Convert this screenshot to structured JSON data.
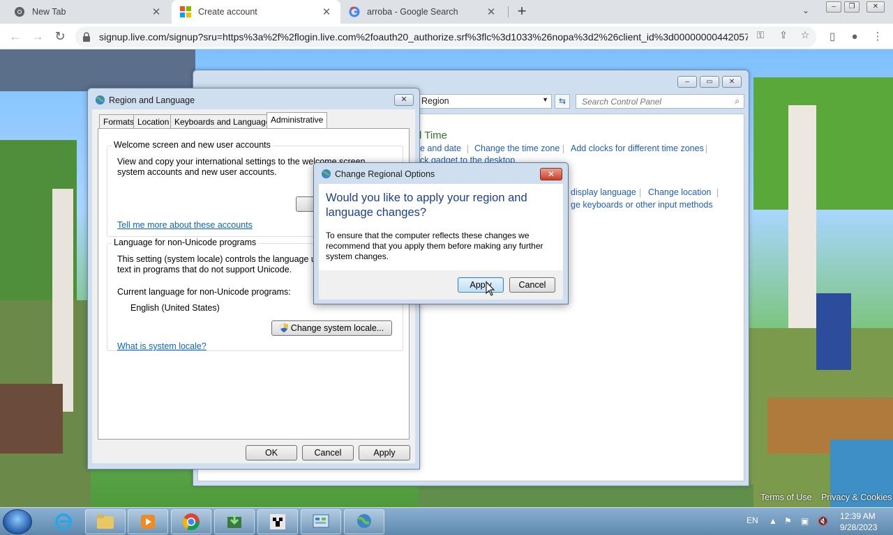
{
  "browser": {
    "tabs": [
      {
        "title": "New Tab",
        "icon": "chrome-icon"
      },
      {
        "title": "Create account",
        "icon": "microsoft-logo-icon"
      },
      {
        "title": "arroba - Google Search",
        "icon": "google-icon"
      }
    ],
    "new_tab_label": "+",
    "url": "signup.live.com/signup?sru=https%3a%2f%2flogin.live.com%2foauth20_authorize.srf%3flc%3d1033%26nopa%3d2%26client_id%3d00000000442057..."
  },
  "control_panel": {
    "address": "Region",
    "search_placeholder": "Search Control Panel",
    "section_title": "d Time",
    "links": {
      "date": "e and date",
      "time_zone": "Change the time zone",
      "clocks": "Add clocks for different time zones",
      "gadget": "ck gadget to the desktop",
      "display_language": "display language",
      "location": "Change location",
      "keyboards": "ge keyboards or other input methods"
    }
  },
  "region_language": {
    "title": "Region and Language",
    "close_label": "✕",
    "tabs": [
      "Formats",
      "Location",
      "Keyboards and Languages",
      "Administrative"
    ],
    "welcome": {
      "label": "Welcome screen and new user accounts",
      "text": "View and copy your international settings to the welcome screen, system accounts and new user accounts.",
      "link": "Tell me more about these accounts"
    },
    "unicode": {
      "label": "Language for non-Unicode programs",
      "text": "This setting (system locale) controls the language used when displaying text in programs that do not support Unicode.",
      "current_label": "Current language for non-Unicode programs:",
      "current_value": "English (United States)",
      "change_button": "Change system locale...",
      "link": "What is system locale?"
    },
    "buttons": {
      "ok": "OK",
      "cancel": "Cancel",
      "apply": "Apply"
    }
  },
  "change_options": {
    "title": "Change Regional Options",
    "close_label": "✕",
    "heading": "Would you like to apply your region and language changes?",
    "text": "To ensure that the computer reflects these changes we recommend that you apply them before making any further system changes.",
    "apply": "Apply",
    "cancel": "Cancel"
  },
  "page_footer": {
    "terms": "Terms of Use",
    "privacy": "Privacy & Cookies"
  },
  "taskbar": {
    "apps": [
      "internet-explorer-icon",
      "folder-icon",
      "media-player-icon",
      "chrome-icon",
      "download-app-icon",
      "creeper-icon",
      "control-panel-icon",
      "region-globe-icon"
    ],
    "language": "EN",
    "time": "12:39 AM",
    "date": "9/28/2023"
  },
  "colors": {
    "link": "#1e5eb8",
    "heading_blue": "#1e3f8a",
    "cp_heading_green": "#2a7a2a"
  }
}
